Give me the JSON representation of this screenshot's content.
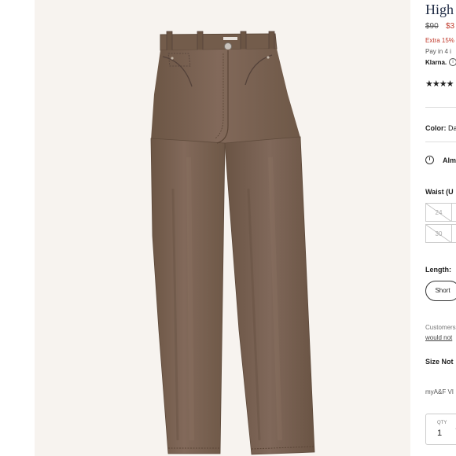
{
  "product": {
    "title": "High",
    "price_original": "$90",
    "price_sale": "$3",
    "promo_text": "Extra 15%",
    "pay_text": "Pay in 4 i",
    "klarna_label": "Klarna.",
    "klarna_info_glyph": "i",
    "rating_stars": "★★★★",
    "color_label": "Color:",
    "color_value": "Da",
    "availability_text": "Alm",
    "waist_label": "Waist (U",
    "waist_sizes": [
      "24",
      "30"
    ],
    "length_label": "Length:",
    "length_options": [
      "Short"
    ],
    "customer_text": "Customers",
    "customer_link": "would not",
    "size_note": "Size Not",
    "myaf_text": "myA&F VI",
    "qty_label": "QTY",
    "qty_value": "1",
    "qty_arrow": "⌃"
  },
  "colors": {
    "denim_brown": "#7a6351",
    "denim_dark": "#5e4a3b",
    "background": "#f7f3ef",
    "sale_red": "#c0392b",
    "title_navy": "#1f2b44"
  }
}
